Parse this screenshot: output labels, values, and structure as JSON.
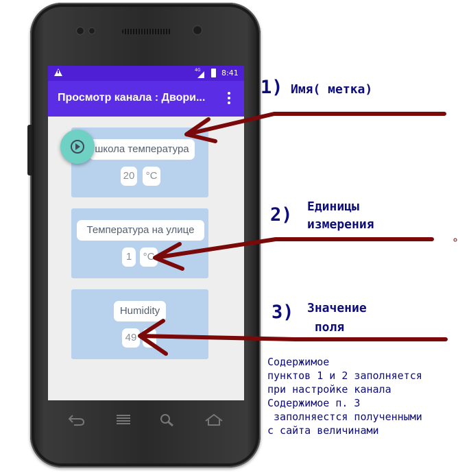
{
  "status_bar": {
    "network": "4G",
    "time": "8:41"
  },
  "app_bar": {
    "title": "Просмотр канала : Двори..."
  },
  "widgets": [
    {
      "name": "школа температура",
      "value": "20",
      "unit": "°C"
    },
    {
      "name": "Температура на улице",
      "value": "1",
      "unit": "°C"
    },
    {
      "name": "Humidity",
      "value": "49",
      "unit": ""
    }
  ],
  "annotations": [
    {
      "number": "1)",
      "text": "Имя( метка)"
    },
    {
      "number": "2)",
      "text": "Единицы\nизмерения"
    },
    {
      "number": "3)",
      "text": "Значение\n поля"
    }
  ],
  "note": "Содержимое\nпунктов 1 и 2 заполняется\nпри настройке канала\nСодержимое п. 3\n заполняестся полученными\nс сайта величинами",
  "colors": {
    "accent": "#5b2ee6",
    "status_bar": "#4f1fd6",
    "card": "#b8d2ee",
    "fab": "#6fd1c3",
    "arrow": "#7a0a0a",
    "annotation_text": "#0b0b7a"
  },
  "icons": [
    "warning-icon",
    "signal-icon",
    "battery-icon",
    "more-vert-icon",
    "play-circle-icon",
    "back-icon",
    "menu-icon",
    "search-icon",
    "home-icon"
  ]
}
